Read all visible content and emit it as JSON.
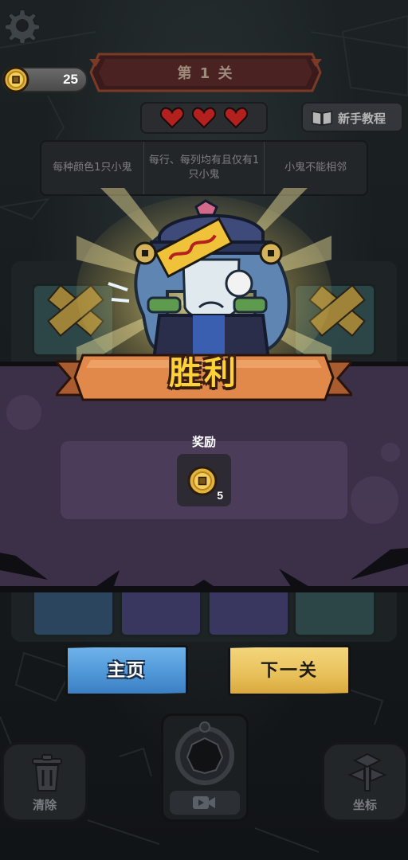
{
  "top_bar": {
    "coins": "25",
    "level_label": "第 1 关",
    "lives": 3,
    "tutorial_label": "新手教程"
  },
  "rules": [
    "每种颜色1只小鬼",
    "每行、每列均有且仅有1只小鬼",
    "小鬼不能相邻"
  ],
  "victory": {
    "title": "胜利",
    "reward_label": "奖励",
    "reward_quantity": "5",
    "reward_icon": "coin-icon"
  },
  "buttons": {
    "home_label": "主页",
    "next_label": "下一关"
  },
  "tools": {
    "clear_label": "清除",
    "coord_label": "坐标",
    "clear_icon": "trash-icon",
    "coord_icon": "signpost-icon",
    "hint_icon": "bagua-medallion-icon",
    "video_icon": "video-icon"
  },
  "colors": {
    "panel": "#3c3049",
    "ribbon": "#e0894b",
    "title": "#ffd23a",
    "home_button": "#4d95d6",
    "next_button": "#e8c05a",
    "heart": "#b3201e"
  }
}
